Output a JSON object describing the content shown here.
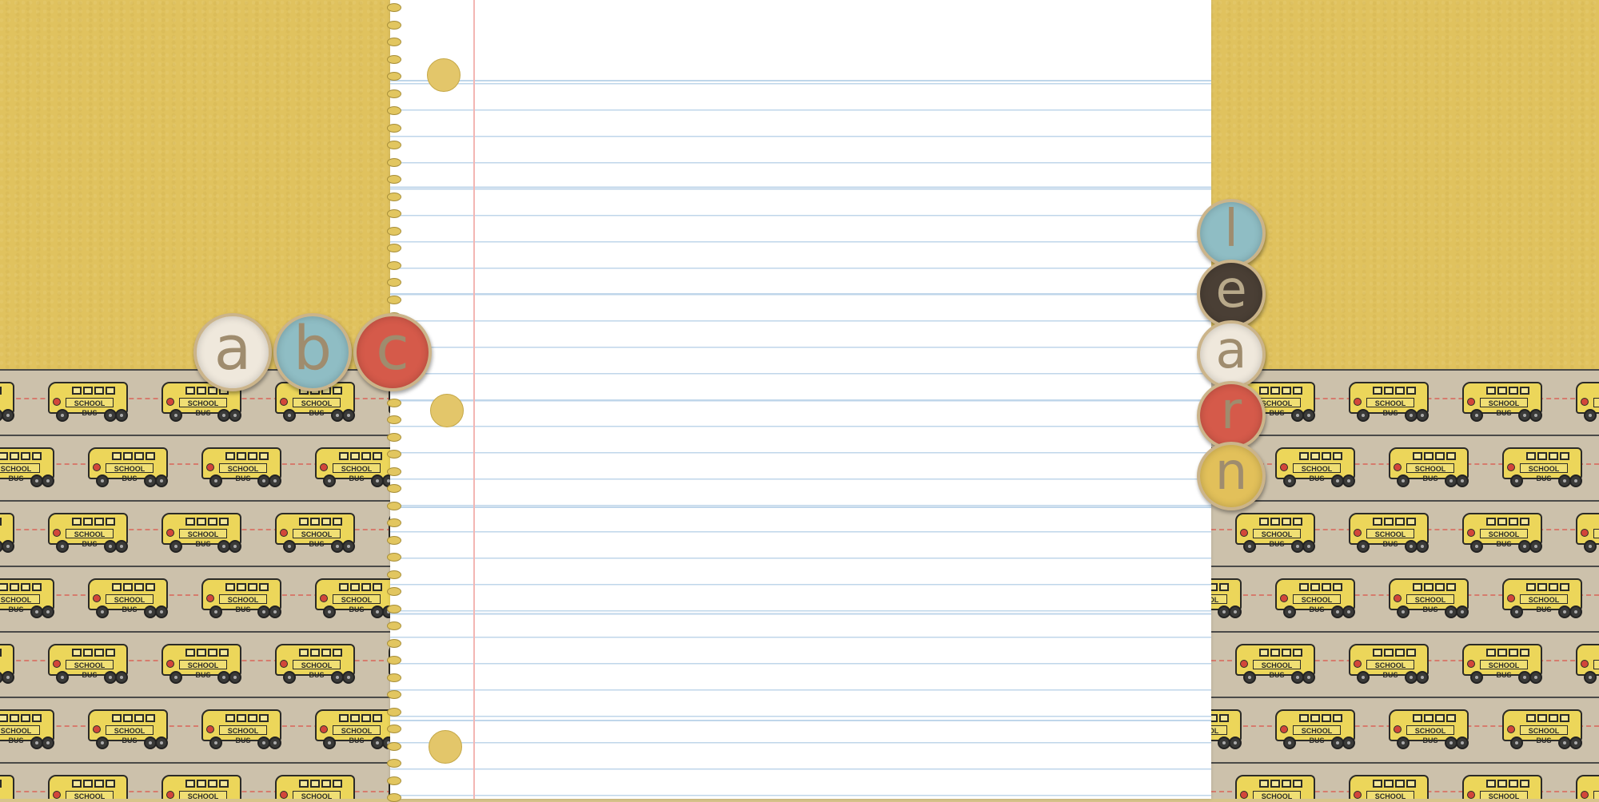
{
  "bus_label": "SCHOOL BUS",
  "colors": {
    "kraft_yellow": "#e0c25e",
    "bus_paper": "#ccc1ab",
    "bus_yellow": "#ecd65a",
    "notebook_paper": "#ffffff",
    "rule_blue": "#bfd6ea",
    "margin_red": "#f3b6b3"
  },
  "abc_letters": [
    {
      "letter": "a",
      "color": "#efe8dc"
    },
    {
      "letter": "b",
      "color": "#8fbdc4"
    },
    {
      "letter": "c",
      "color": "#d55a4a"
    }
  ],
  "learn_letters": [
    {
      "letter": "l",
      "color": "#8fbdc4"
    },
    {
      "letter": "e",
      "color": "#4a3f35"
    },
    {
      "letter": "a",
      "color": "#efe8dc"
    },
    {
      "letter": "r",
      "color": "#d55a4a"
    },
    {
      "letter": "n",
      "color": "#e2c05a"
    }
  ]
}
